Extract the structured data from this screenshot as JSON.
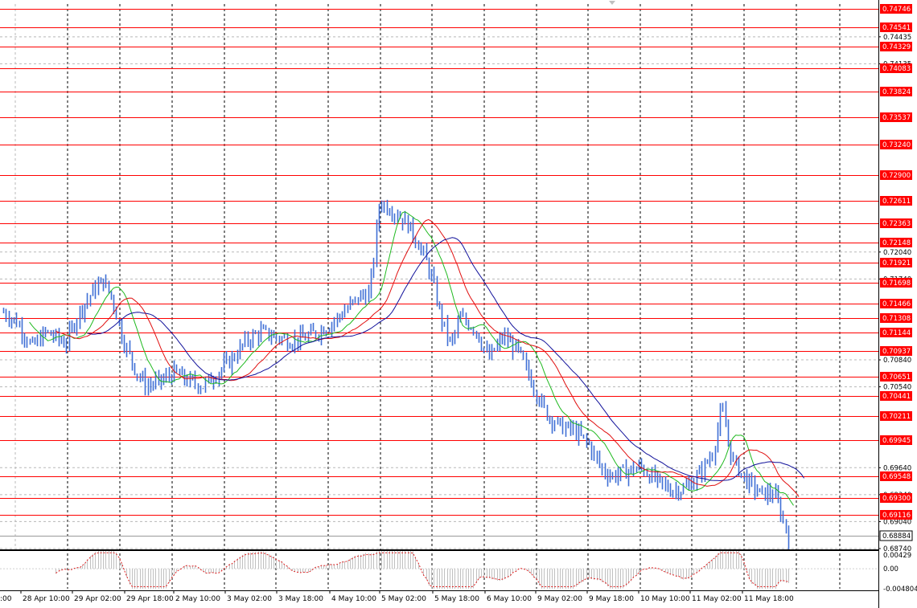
{
  "chart_data": [
    {
      "type": "line",
      "title": "",
      "xlabel": "",
      "ylabel": "",
      "ylim": [
        0.6874,
        0.748
      ],
      "x": [
        "28 Apr 10:00",
        "29 Apr 02:00",
        "29 Apr 18:00",
        "2 May 10:00",
        "3 May 02:00",
        "3 May 18:00",
        "4 May 10:00",
        "5 May 02:00",
        "5 May 18:00",
        "6 May 10:00",
        "9 May 02:00",
        "9 May 18:00",
        "10 May 10:00",
        "11 May 02:00",
        "11 May 18:00"
      ],
      "x_partial_first": ":00",
      "price_ticks": [
        "0.74435",
        "0.74135",
        "0.72040",
        "0.71740",
        "0.70840",
        "0.70540",
        "0.69640",
        "0.69340",
        "0.69040",
        "0.68740"
      ],
      "price_tick_values": [
        0.74435,
        0.74135,
        0.7204,
        0.7174,
        0.7084,
        0.7054,
        0.6964,
        0.6934,
        0.6904,
        0.6874
      ],
      "levels": [
        "0.74746",
        "0.74541",
        "0.74329",
        "0.74083",
        "0.73824",
        "0.73537",
        "0.73240",
        "0.72900",
        "0.72611",
        "0.72363",
        "0.72148",
        "0.71921",
        "0.71698",
        "0.71466",
        "0.71308",
        "0.71144",
        "0.70937",
        "0.70651",
        "0.70441",
        "0.70211",
        "0.69945",
        "0.69548",
        "0.69300",
        "0.69116"
      ],
      "level_values": [
        0.74746,
        0.74541,
        0.74329,
        0.74083,
        0.73824,
        0.73537,
        0.7324,
        0.729,
        0.72611,
        0.72363,
        0.72148,
        0.71921,
        0.71698,
        0.71466,
        0.71308,
        0.71144,
        0.70937,
        0.70651,
        0.70441,
        0.70211,
        0.69945,
        0.69548,
        0.693,
        0.69116
      ],
      "current_price": "0.68884",
      "current_price_value": 0.68884,
      "price_anchors": [
        [
          0,
          0.7137
        ],
        [
          0.03,
          0.7125
        ],
        [
          0.06,
          0.7098
        ],
        [
          0.09,
          0.7115
        ],
        [
          0.13,
          0.7102
        ],
        [
          0.16,
          0.7138
        ],
        [
          0.19,
          0.7162
        ],
        [
          0.21,
          0.7172
        ],
        [
          0.23,
          0.715
        ],
        [
          0.25,
          0.7108
        ],
        [
          0.28,
          0.707
        ],
        [
          0.3,
          0.7055
        ],
        [
          0.33,
          0.706
        ],
        [
          0.36,
          0.707
        ],
        [
          0.39,
          0.706
        ],
        [
          0.42,
          0.7055
        ],
        [
          0.45,
          0.707
        ],
        [
          0.48,
          0.7085
        ],
        [
          0.51,
          0.7105
        ],
        [
          0.54,
          0.7115
        ],
        [
          0.57,
          0.711
        ],
        [
          0.6,
          0.7105
        ],
        [
          0.63,
          0.7108
        ],
        [
          0.66,
          0.7115
        ],
        [
          0.69,
          0.7125
        ],
        [
          0.72,
          0.714
        ],
        [
          0.75,
          0.7155
        ],
        [
          0.77,
          0.7158
        ],
        [
          0.79,
          0.726
        ],
        [
          0.82,
          0.725
        ],
        [
          0.85,
          0.7235
        ],
        [
          0.88,
          0.7205
        ],
        [
          0.9,
          0.7175
        ],
        [
          0.92,
          0.713
        ],
        [
          0.94,
          0.71
        ],
        [
          0.96,
          0.713
        ],
        [
          0.99,
          0.712
        ],
        [
          1.02,
          0.7085
        ],
        [
          1.05,
          0.711
        ],
        [
          1.08,
          0.7095
        ],
        [
          1.11,
          0.706
        ],
        [
          1.14,
          0.7025
        ],
        [
          1.17,
          0.701
        ],
        [
          1.2,
          0.7005
        ],
        [
          1.23,
          0.699
        ],
        [
          1.26,
          0.696
        ],
        [
          1.28,
          0.6955
        ],
        [
          1.31,
          0.696
        ],
        [
          1.34,
          0.6965
        ],
        [
          1.37,
          0.695
        ],
        [
          1.4,
          0.694
        ],
        [
          1.43,
          0.694
        ],
        [
          1.46,
          0.6955
        ],
        [
          1.49,
          0.698
        ],
        [
          1.51,
          0.703
        ],
        [
          1.53,
          0.6975
        ],
        [
          1.56,
          0.695
        ],
        [
          1.59,
          0.6935
        ],
        [
          1.62,
          0.6935
        ],
        [
          1.65,
          0.6888
        ]
      ],
      "series": [
        {
          "color": "#3f6fd6",
          "values": []
        },
        {
          "color": "#1fb91f",
          "values": []
        },
        {
          "color": "#e01010",
          "values": []
        },
        {
          "color": "#10109a",
          "values": []
        }
      ],
      "colors": {
        "grid": "#b8b8b8",
        "level_line": "#ff0000",
        "level_label_bg": "#ff0000",
        "bars": "#3f6fd6",
        "ma_fast": "#1fb91f",
        "ma_mid": "#e01010",
        "ma_slow": "#10109a"
      }
    },
    {
      "type": "bar",
      "title": "",
      "ylim": [
        -0.004804,
        0.00429
      ],
      "ticks": [
        "0.00429",
        "0.00",
        "-0.004804"
      ],
      "signal_color": "#e02020",
      "hist_color": "#c0c0c0"
    }
  ]
}
